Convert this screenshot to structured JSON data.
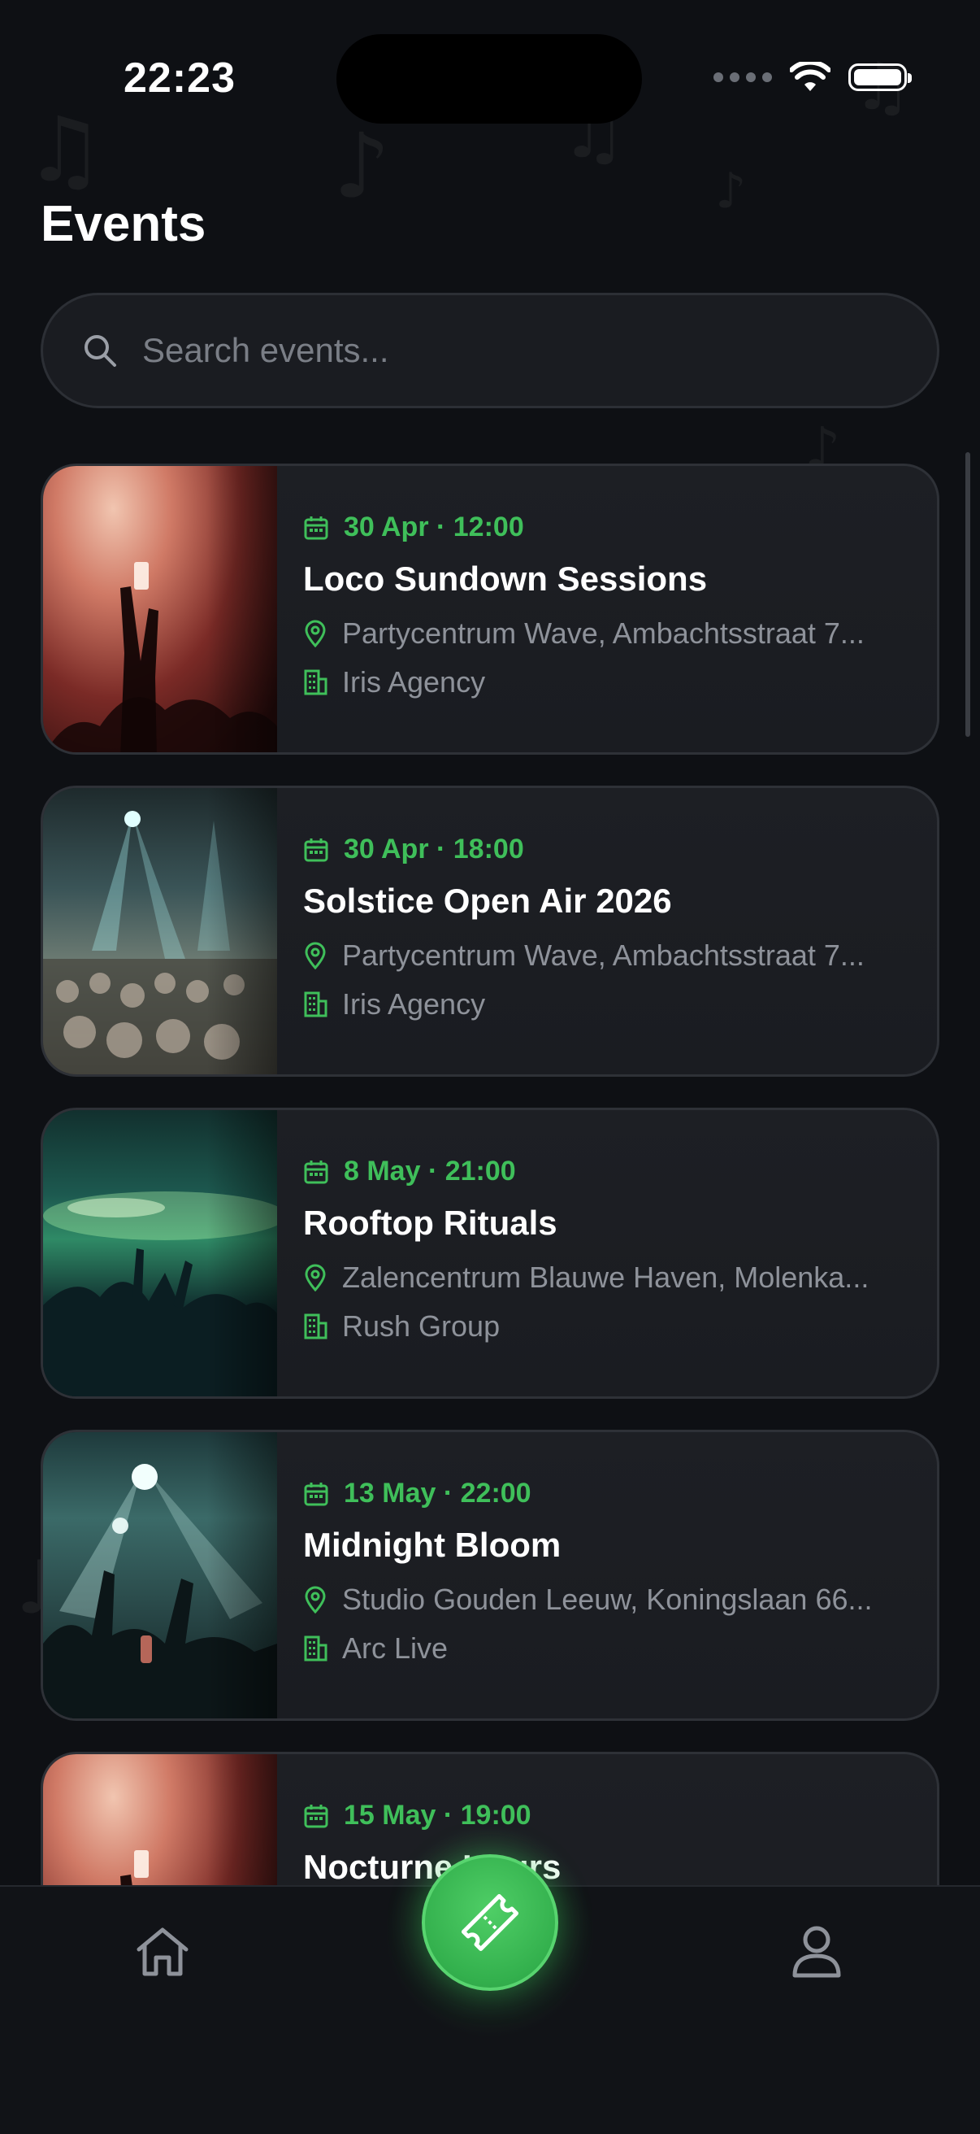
{
  "status_bar": {
    "time": "22:23"
  },
  "header": {
    "title": "Events"
  },
  "search": {
    "placeholder": "Search events..."
  },
  "events": [
    {
      "date": "30 Apr · 12:00",
      "title": "Loco Sundown Sessions",
      "venue": "Partycentrum Wave, Ambachtsstraat 7...",
      "organizer": "Iris Agency"
    },
    {
      "date": "30 Apr · 18:00",
      "title": "Solstice Open Air 2026",
      "venue": "Partycentrum Wave, Ambachtsstraat 7...",
      "organizer": "Iris Agency"
    },
    {
      "date": "8 May · 21:00",
      "title": "Rooftop Rituals",
      "venue": "Zalencentrum Blauwe Haven, Molenka...",
      "organizer": "Rush Group"
    },
    {
      "date": "13 May · 22:00",
      "title": "Midnight Bloom",
      "venue": "Studio Gouden Leeuw, Koningslaan 66...",
      "organizer": "Arc Live"
    },
    {
      "date": "15 May · 19:00",
      "title": "Nocturne Hours",
      "venue": "",
      "organizer": ""
    }
  ],
  "icons": {
    "search": "search-icon",
    "calendar": "calendar-icon",
    "location": "map-pin-icon",
    "organizer": "building-icon",
    "home": "home-icon",
    "tickets": "ticket-icon",
    "profile": "user-icon"
  },
  "colors": {
    "background": "#0e1014",
    "card": "#1b1d22",
    "accent": "#3fbf5a",
    "muted_text": "#8e929a"
  }
}
